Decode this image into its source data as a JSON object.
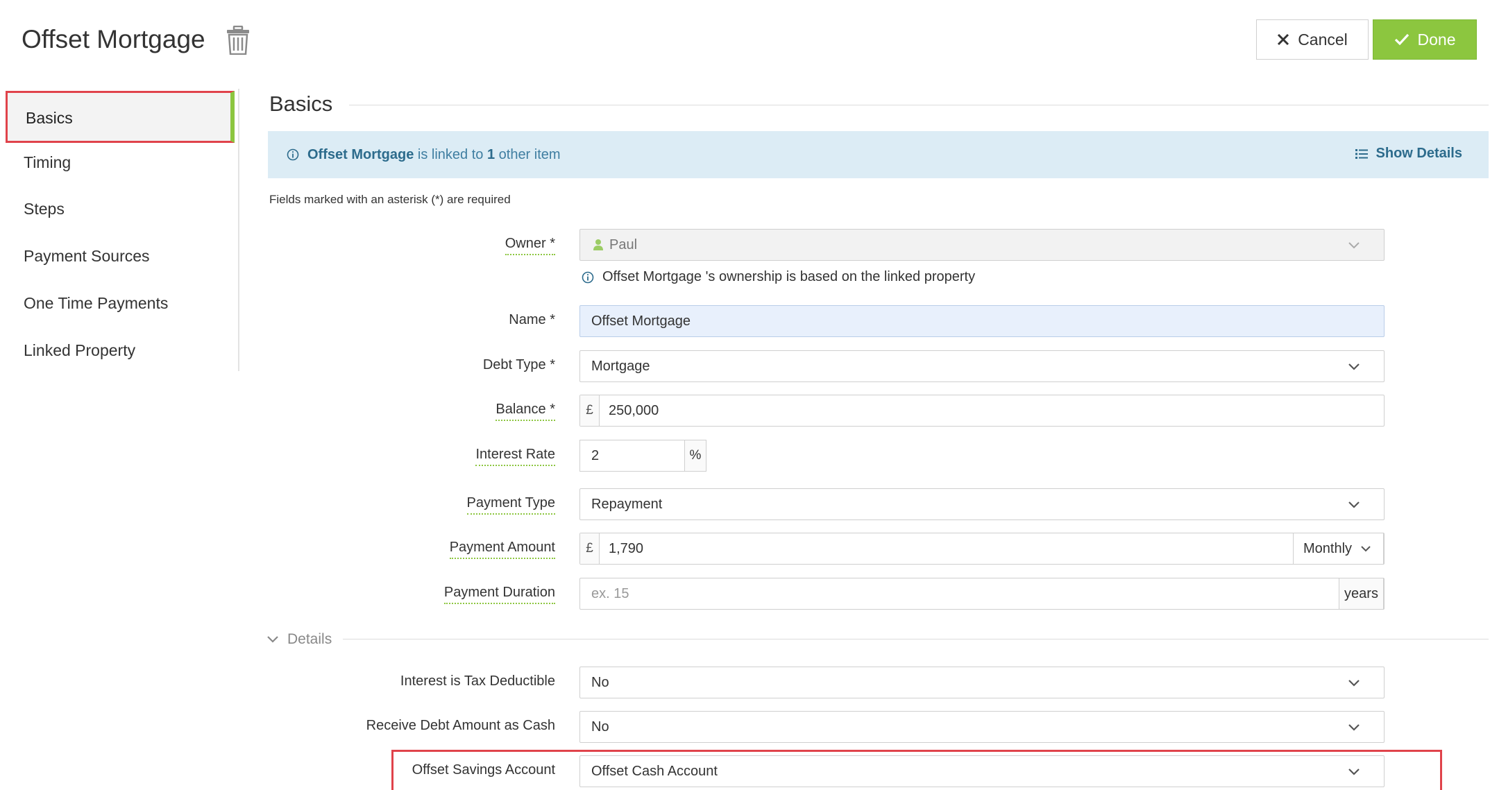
{
  "header": {
    "title": "Offset Mortgage",
    "cancel_label": "Cancel",
    "done_label": "Done"
  },
  "sidebar": {
    "items": [
      {
        "label": "Basics",
        "active": true
      },
      {
        "label": "Timing"
      },
      {
        "label": "Steps"
      },
      {
        "label": "Payment Sources"
      },
      {
        "label": "One Time Payments"
      },
      {
        "label": "Linked Property"
      }
    ]
  },
  "section": {
    "title": "Basics"
  },
  "info_bar": {
    "item_name": "Offset Mortgage",
    "linked_text_1": " is linked to ",
    "count": "1",
    "linked_text_2": " other item",
    "show_details_label": "Show Details"
  },
  "required_note": "Fields marked with an asterisk (*) are required",
  "form": {
    "owner": {
      "label": "Owner *",
      "value": "Paul",
      "note": "Offset Mortgage 's ownership is based on the linked property"
    },
    "name": {
      "label": "Name *",
      "value": "Offset Mortgage"
    },
    "debt_type": {
      "label": "Debt Type *",
      "value": "Mortgage"
    },
    "balance": {
      "label": "Balance *",
      "currency": "£",
      "value": "250,000"
    },
    "interest_rate": {
      "label": "Interest Rate",
      "value": "2",
      "unit": "%"
    },
    "payment_type": {
      "label": "Payment Type",
      "value": "Repayment"
    },
    "payment_amount": {
      "label": "Payment Amount",
      "currency": "£",
      "value": "1,790",
      "frequency": "Monthly"
    },
    "payment_duration": {
      "label": "Payment Duration",
      "placeholder": "ex. 15",
      "unit": "years"
    }
  },
  "details": {
    "toggle_label": "Details",
    "interest_tax": {
      "label": "Interest is Tax Deductible",
      "value": "No"
    },
    "receive_cash": {
      "label": "Receive Debt Amount as Cash",
      "value": "No"
    },
    "offset_account": {
      "label": "Offset Savings Account",
      "value": "Offset Cash Account"
    }
  },
  "colors": {
    "accent_green": "#8cc63f",
    "highlight_red": "#e0434b",
    "info_bg": "#dcecf5",
    "info_text": "#2c6b8c"
  }
}
